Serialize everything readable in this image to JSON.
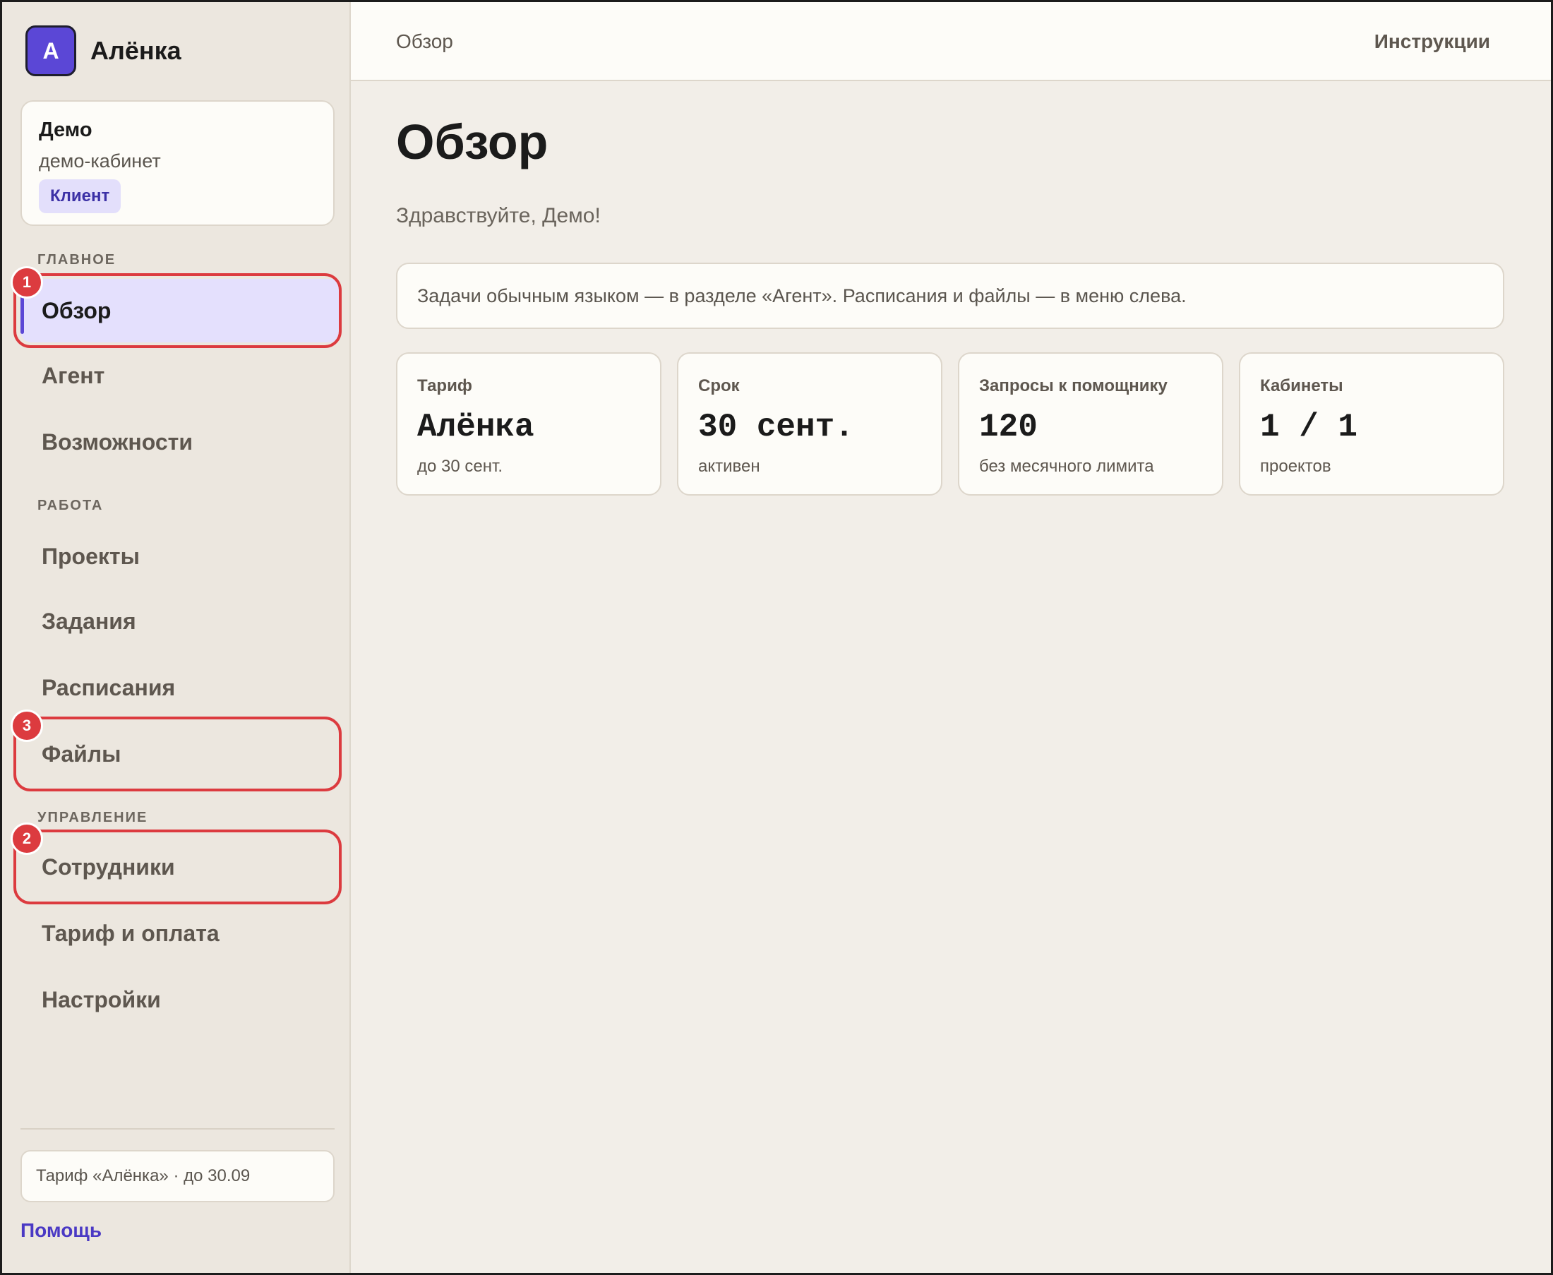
{
  "brand": {
    "avatar_letter": "А",
    "name": "Алёнка"
  },
  "account": {
    "name": "Демо",
    "subtitle": "демо-кабинет",
    "role_badge": "Клиент"
  },
  "sidebar": {
    "sections": {
      "main": "ГЛАВНОЕ",
      "work": "РАБОТА",
      "management": "УПРАВЛЕНИЕ"
    },
    "items": {
      "overview": "Обзор",
      "agent": "Агент",
      "features": "Возможности",
      "projects": "Проекты",
      "tasks": "Задания",
      "schedules": "Расписания",
      "files": "Файлы",
      "employees": "Сотрудники",
      "billing": "Тариф и оплата",
      "settings": "Настройки"
    },
    "active_item": "overview",
    "plan_summary": "Тариф «Алёнка» · до 30.09",
    "help_link": "Помощь"
  },
  "annotations": {
    "overview": "1",
    "employees": "2",
    "files": "3"
  },
  "topbar": {
    "breadcrumb": "Обзор",
    "instructions_link": "Инструкции"
  },
  "main": {
    "title": "Обзор",
    "greeting": "Здравствуйте, Демо!",
    "info": "Задачи обычным языком — в разделе «Агент». Расписания и файлы — в меню слева.",
    "stats": [
      {
        "label": "Тариф",
        "value": "Алёнка",
        "sub": "до 30 сент."
      },
      {
        "label": "Срок",
        "value": "30 сент.",
        "sub": "активен"
      },
      {
        "label": "Запросы к помощнику",
        "value": "120",
        "sub": "без месячного лимита"
      },
      {
        "label": "Кабинеты",
        "value": "1 / 1",
        "sub": "проектов"
      }
    ]
  },
  "colors": {
    "accent": "#5b47d6",
    "annotation_red": "#dc3b3f",
    "active_bg": "#e4e0fd",
    "sidebar_bg": "#ece7df",
    "main_bg": "#f2eee8"
  }
}
